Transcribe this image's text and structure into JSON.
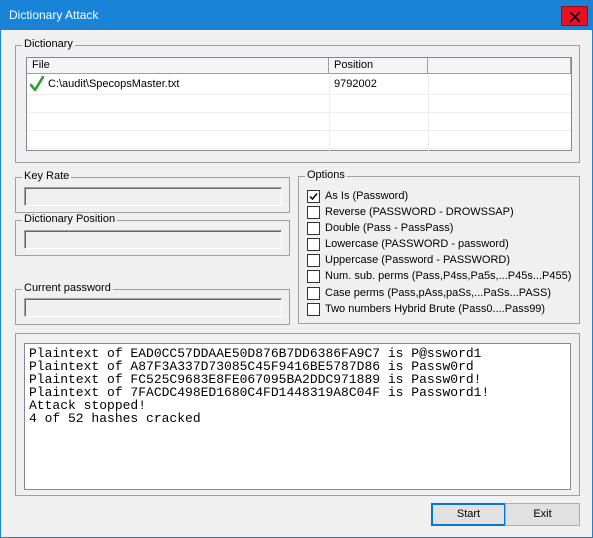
{
  "window": {
    "title": "Dictionary Attack"
  },
  "dictionary": {
    "label": "Dictionary",
    "columns": [
      "File",
      "Position"
    ],
    "rows": [
      {
        "file": "C:\\audit\\SpecopsMaster.txt",
        "position": "9792002",
        "status_icon": "green-checkmark-icon"
      }
    ]
  },
  "key_rate": {
    "label": "Key Rate",
    "value": ""
  },
  "dictionary_position": {
    "label": "Dictionary Position",
    "value": ""
  },
  "current_password": {
    "label": "Current password",
    "value": ""
  },
  "options": {
    "label": "Options",
    "items": [
      {
        "label": "As Is (Password)",
        "checked": true
      },
      {
        "label": "Reverse (PASSWORD - DROWSSAP)",
        "checked": false
      },
      {
        "label": "Double (Pass - PassPass)",
        "checked": false
      },
      {
        "label": "Lowercase (PASSWORD - password)",
        "checked": false
      },
      {
        "label": "Uppercase (Password - PASSWORD)",
        "checked": false
      },
      {
        "label": "Num. sub. perms (Pass,P4ss,Pa5s,...P45s...P455)",
        "checked": false
      },
      {
        "label": "Case perms (Pass,pAss,paSs,...PaSs...PASS)",
        "checked": false
      },
      {
        "label": "Two numbers Hybrid Brute (Pass0....Pass99)",
        "checked": false
      }
    ]
  },
  "output": {
    "lines": [
      "Plaintext of EAD0CC57DDAAE50D876B7DD6386FA9C7 is P@ssword1",
      "Plaintext of A87F3A337D73085C45F9416BE5787D86 is Passw0rd",
      "Plaintext of FC525C9683E8FE067095BA2DDC971889 is Passw0rd!",
      "Plaintext of 7FACDC498ED1680C4FD1448319A8C04F is Password1!",
      "Attack stopped!",
      "4 of 52 hashes cracked"
    ]
  },
  "buttons": {
    "start": "Start",
    "exit": "Exit"
  },
  "colors": {
    "titlebar": "#1883d7",
    "close": "#e81123",
    "check": "#2e9e2e"
  }
}
